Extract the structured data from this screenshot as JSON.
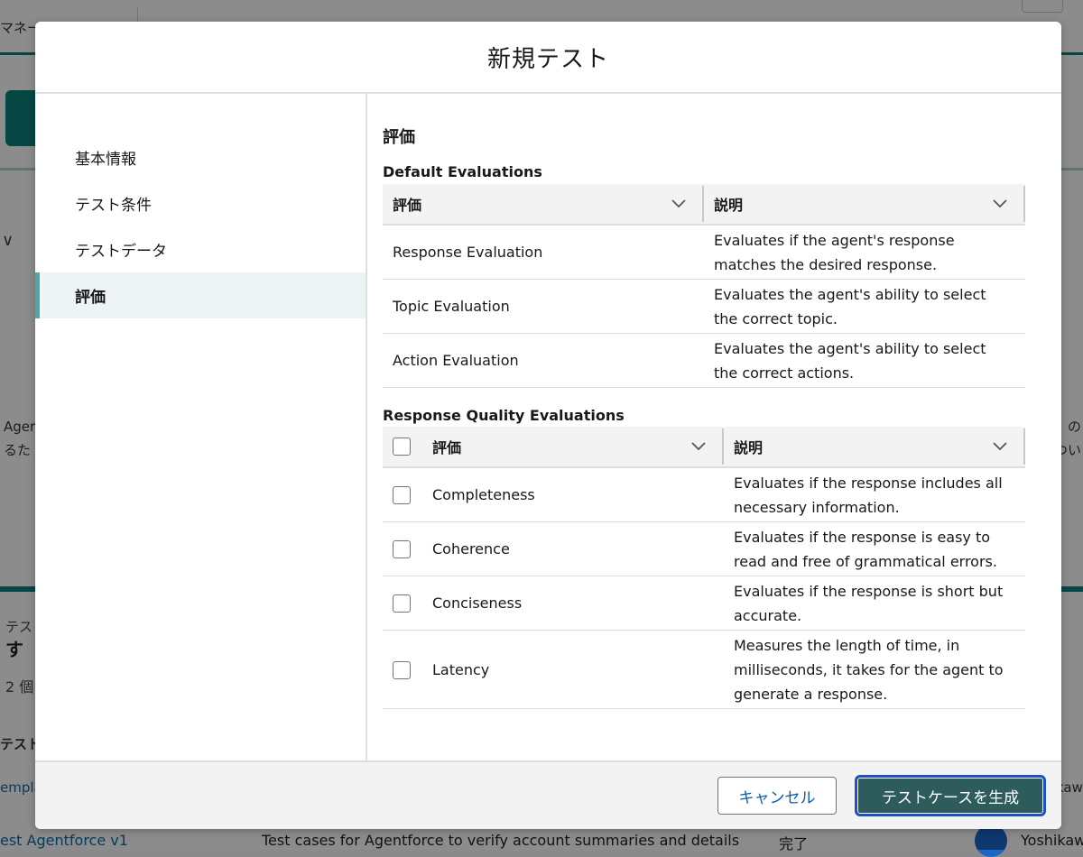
{
  "background": {
    "tab_label": "マネー",
    "text_left": "Ager",
    "text_left2": "るた",
    "text_right": "の",
    "text_right2": "つい",
    "low_label": "テス",
    "low_title": "す",
    "count_label": "2 個",
    "column_header": "テスト",
    "row1_link": "empla",
    "row1_right": "kaw",
    "row2_name": "est Agentforce v1",
    "row2_description": "Test cases for Agentforce to verify account summaries and details",
    "row2_status": "完了",
    "row2_user": "Yoshikaw"
  },
  "modal": {
    "title": "新規テスト",
    "nav": [
      {
        "label": "基本情報",
        "active": false
      },
      {
        "label": "テスト条件",
        "active": false
      },
      {
        "label": "テストデータ",
        "active": false
      },
      {
        "label": "評価",
        "active": true
      }
    ],
    "section_title": "評価",
    "default_evaluations": {
      "title": "Default Evaluations",
      "col_evaluation": "評価",
      "col_description": "説明",
      "rows": [
        {
          "name": "Response Evaluation",
          "description": "Evaluates if the agent's response matches the desired response."
        },
        {
          "name": "Topic Evaluation",
          "description": "Evaluates the agent's ability to select the correct topic."
        },
        {
          "name": "Action Evaluation",
          "description": "Evaluates the agent's ability to select the correct actions."
        }
      ]
    },
    "quality_evaluations": {
      "title": "Response Quality Evaluations",
      "col_evaluation": "評価",
      "col_description": "説明",
      "rows": [
        {
          "name": "Completeness",
          "description": "Evaluates if the response includes all necessary information.",
          "checked": false
        },
        {
          "name": "Coherence",
          "description": "Evaluates if the response is easy to read and free of grammatical errors.",
          "checked": false
        },
        {
          "name": "Conciseness",
          "description": "Evaluates if the response is short but accurate.",
          "checked": false
        },
        {
          "name": "Latency",
          "description": "Measures the length of time, in milliseconds, it takes for the agent to generate a response.",
          "checked": false
        }
      ]
    },
    "footer": {
      "cancel_label": "キャンセル",
      "generate_label": "テストケースを生成"
    }
  },
  "colors": {
    "accent_teal": "#0b827c",
    "primary_button": "#2e5c5c",
    "focus_ring": "#1b52c7",
    "link_blue": "#0b5cab"
  }
}
